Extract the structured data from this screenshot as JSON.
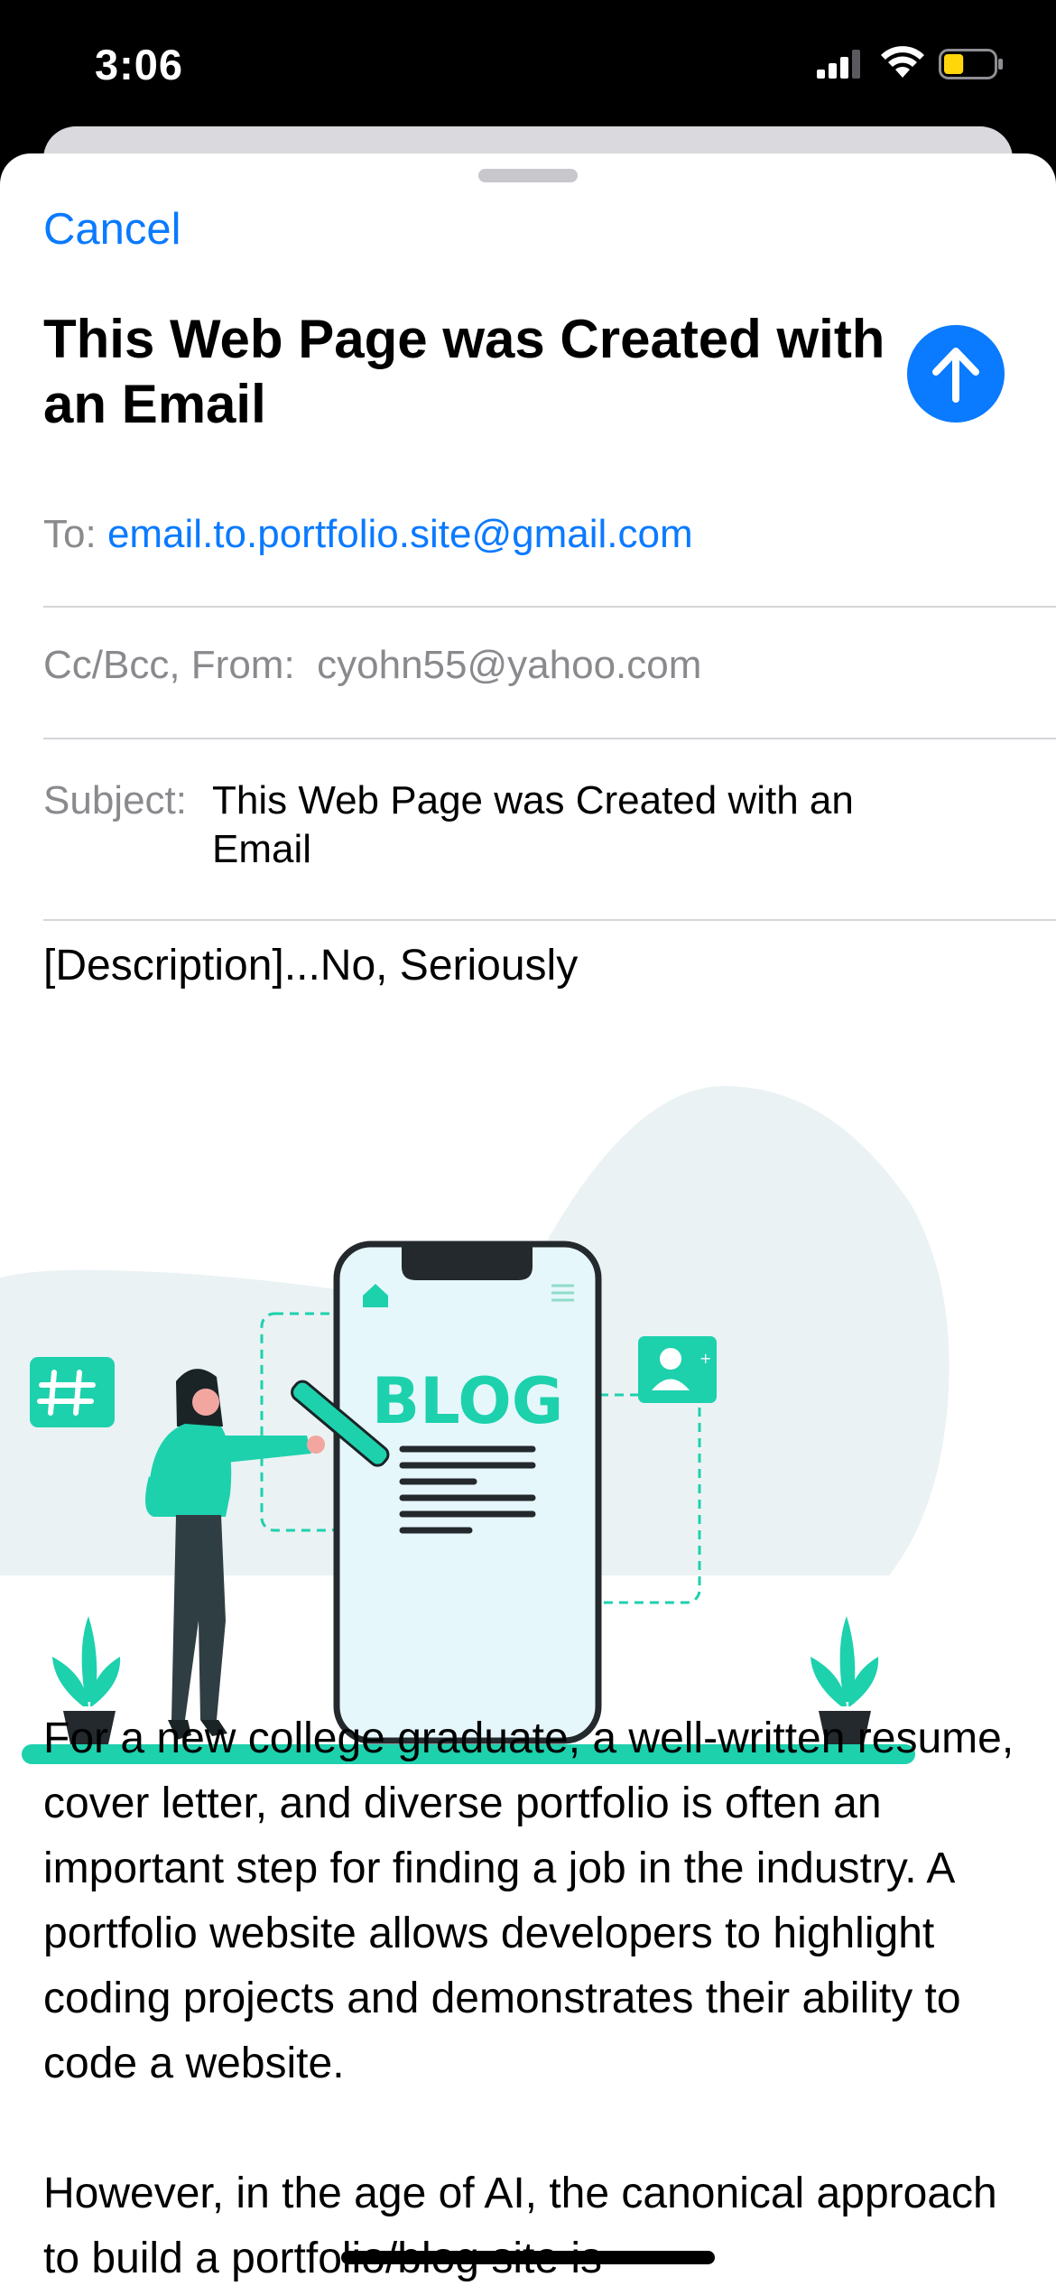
{
  "status_bar": {
    "time": "3:06",
    "battery_level": 0.4,
    "battery_color": "#ffd60a"
  },
  "compose": {
    "cancel_label": "Cancel",
    "title": "This Web Page was Created with an Email",
    "to_label": "To:",
    "to_value": "email.to.portfolio.site@gmail.com",
    "ccbcc_label": "Cc/Bcc, From:",
    "from_value": "cyohn55@yahoo.com",
    "subject_label": "Subject:",
    "subject_value": "This Web Page was Created with an Email",
    "body_heading": "[Description]...No, Seriously",
    "illustration": {
      "phone_text": "BLOG",
      "accent_color": "#1dd1ad"
    },
    "paragraphs": [
      "For a new college graduate, a well-written resume, cover letter, and diverse portfolio is often an important step for finding a job in the industry. A portfolio website allows developers to highlight coding projects and demonstrates their ability to code a website.",
      "However, in the age of AI, the canonical approach to build a portfolio/blog site is"
    ]
  },
  "colors": {
    "accent_blue": "#0a7aff",
    "secondary_text": "#8a8a8e"
  }
}
